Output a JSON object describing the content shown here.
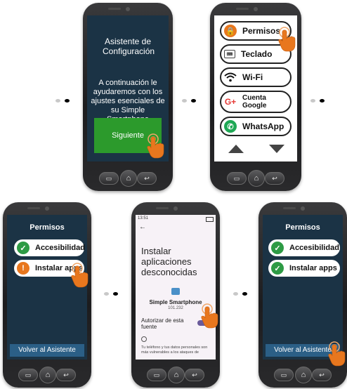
{
  "phone1": {
    "title": "Asistente de Configuración",
    "body": "A continuación le ayudaremos con los ajustes esenciales de su Simple Smartphone",
    "next_button": "Siguiente"
  },
  "phone2": {
    "items": [
      {
        "label": "Permisos",
        "icon": "lock-icon",
        "color": "#e8771e"
      },
      {
        "label": "Teclado",
        "icon": "keyboard-icon",
        "color": "#444444"
      },
      {
        "label": "Wi-Fi",
        "icon": "wifi-icon",
        "color": "#222222"
      },
      {
        "label": "Cuenta Google",
        "icon": "google-plus-icon",
        "color": "#e53935"
      },
      {
        "label": "WhatsApp",
        "icon": "whatsapp-icon",
        "color": "#1fa855"
      }
    ],
    "scroll_up_icon": "arrow-up-icon",
    "scroll_down_icon": "arrow-down-icon"
  },
  "phone3": {
    "title": "Permisos",
    "items": [
      {
        "label": "Accesibilidad",
        "status": "done",
        "color": "#2e9b45"
      },
      {
        "label": "Instalar apps",
        "status": "warning",
        "color": "#e8771e"
      }
    ],
    "back_button": "Volver al Asistente"
  },
  "phone4": {
    "status_time": "13:51",
    "back_icon": "back-arrow-icon",
    "heading": "Instalar aplicaciones desconocidas",
    "app_name": "Simple Smartphone",
    "app_version": "101.232",
    "toggle_label": "Autorizar de esta fuente",
    "info_icon": "info-icon",
    "warning_text": "Tu teléfono y tus datos personales son más vulnerables a los ataques de"
  },
  "phone5": {
    "title": "Permisos",
    "items": [
      {
        "label": "Accesibilidad",
        "status": "done",
        "color": "#2e9b45"
      },
      {
        "label": "Instalar apps",
        "status": "done",
        "color": "#2e9b45"
      }
    ],
    "back_button": "Volver al Asistente"
  },
  "nav": {
    "recent": "▭",
    "home": "⌂",
    "back": "↩"
  },
  "colors": {
    "screen_bg": "#1b3345",
    "accent_green": "#2c9a2c",
    "touch": "#e8771e"
  }
}
